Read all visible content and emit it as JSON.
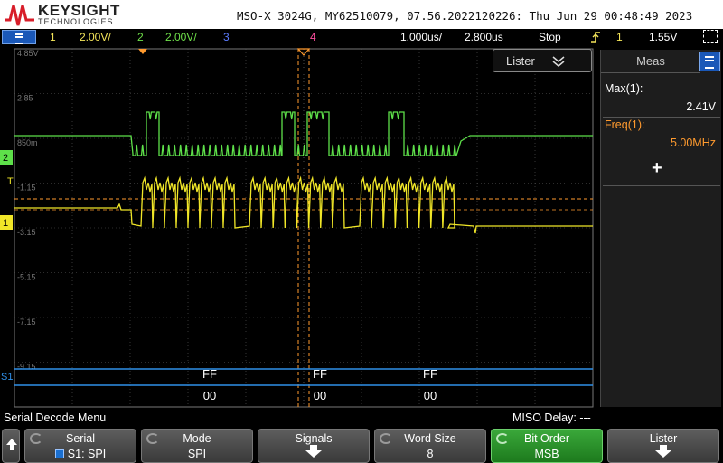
{
  "header": {
    "brand": "KEYSIGHT",
    "brand_sub": "TECHNOLOGIES",
    "instrument_title": "MSO-X 3024G, MY62510079, 07.56.2022120226: Thu Jun 29 00:48:49 2023"
  },
  "status": {
    "ch1_num": "1",
    "ch1_scale": "2.00V/",
    "ch2_num": "2",
    "ch2_scale": "2.00V/",
    "ch3_num": "3",
    "ch4_num": "4",
    "timebase": "1.000us/",
    "delay": "2.800us",
    "run_state": "Stop",
    "trigger_source": "1",
    "trigger_level": "1.55V",
    "icons": {
      "menu": "menu-icon",
      "trigger": "trigger-edge-icon",
      "cursor": "cursor-icon"
    }
  },
  "screen": {
    "grid_labels": [
      "4.85V",
      "2.85",
      "850m",
      "-1.15",
      "-3.15",
      "-5.15",
      "-7.15",
      "-9.15"
    ],
    "ch2_marker": "2",
    "ch1_marker": "1",
    "trigger_marker": "T",
    "serial_marker": "S1",
    "lister_label": "Lister",
    "decode": [
      {
        "top": "FF",
        "bottom": "00"
      },
      {
        "top": "FF",
        "bottom": "00"
      },
      {
        "top": "FF",
        "bottom": "00"
      }
    ],
    "colors": {
      "ch1": "#f0e628",
      "ch2": "#5ee04a",
      "serial": "#2f8fe8",
      "grid": "#5a5a5a",
      "trigger_ref": "#ff9a2e"
    }
  },
  "meas": {
    "tab": "Meas",
    "items": [
      {
        "label": "Max(1):",
        "value": "2.41V",
        "label_color": "#ffffff",
        "value_color": "#ffffff"
      },
      {
        "label": "Freq(1):",
        "value": "5.00MHz",
        "label_color": "#ff9a2e",
        "value_color": "#ff9a2e"
      }
    ],
    "add_symbol": "+"
  },
  "menu": {
    "title": "Serial Decode Menu",
    "miso_delay": "MISO Delay: ---"
  },
  "softkeys": [
    {
      "top": "Serial",
      "bottom": "S1: SPI",
      "style": "normal",
      "knob": true,
      "arrow": false
    },
    {
      "top": "Mode",
      "bottom": "SPI",
      "style": "normal",
      "knob": true,
      "arrow": false
    },
    {
      "top": "Signals",
      "bottom": "",
      "style": "normal",
      "knob": false,
      "arrow": true
    },
    {
      "top": "Word Size",
      "bottom": "8",
      "style": "normal",
      "knob": true,
      "arrow": false
    },
    {
      "top": "Bit Order",
      "bottom": "MSB",
      "style": "green",
      "knob": true,
      "arrow": false
    },
    {
      "top": "Lister",
      "bottom": "",
      "style": "normal",
      "knob": false,
      "arrow": true
    }
  ]
}
